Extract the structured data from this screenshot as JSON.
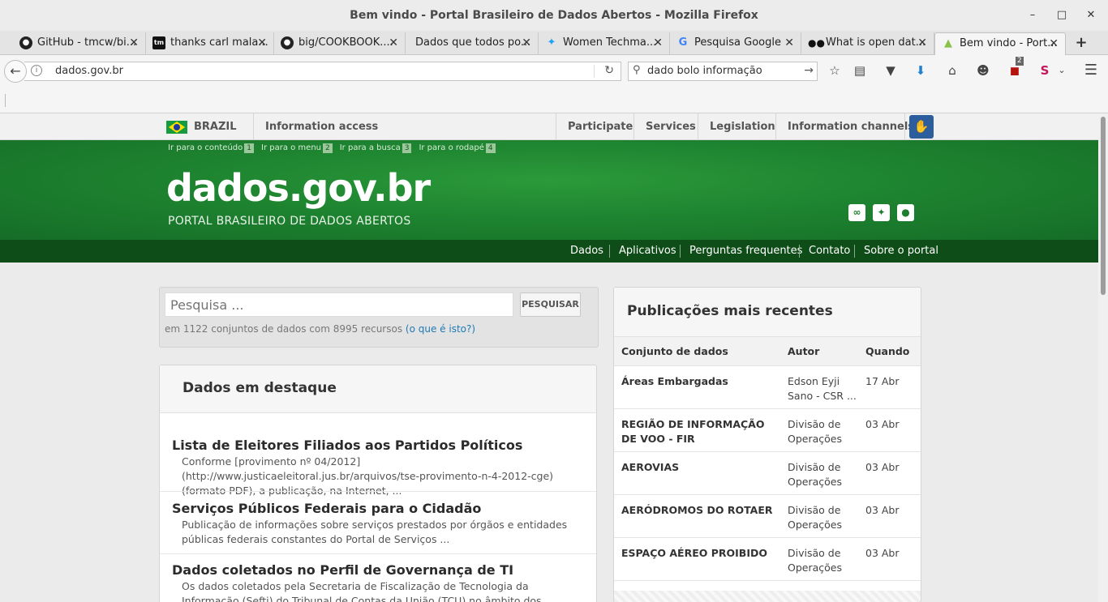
{
  "browser": {
    "window_title": "Bem vindo - Portal Brasileiro de Dados Abertos - Mozilla Firefox",
    "tabs": [
      {
        "label": "GitHub - tmcw/bi...",
        "icon": "github-icon"
      },
      {
        "label": "thanks carl mala...",
        "icon": "tm-icon"
      },
      {
        "label": "big/COOKBOOK....",
        "icon": "github-icon"
      },
      {
        "label": "Dados que todos po...",
        "icon": "none"
      },
      {
        "label": "Women Techma...",
        "icon": "twitter-icon"
      },
      {
        "label": "Pesquisa Google",
        "icon": "google-icon"
      },
      {
        "label": "What is open dat...",
        "icon": "okfn-icon"
      },
      {
        "label": "Bem vindo - Port...",
        "icon": "dados-icon"
      }
    ],
    "url": "dados.gov.br",
    "search_query": "dado bolo informação",
    "badge_count": "2",
    "colors": {
      "accent": "#1f7fd1",
      "active_tab": "#f5f5f5"
    }
  },
  "govbar": {
    "country": "BRAZIL",
    "info_access": "Information access",
    "links": [
      "Participate",
      "Services",
      "Legislation",
      "Information channels"
    ]
  },
  "header": {
    "skip_links": [
      {
        "label": "Ir para o conteúdo",
        "key": "1"
      },
      {
        "label": "Ir para o menu",
        "key": "2"
      },
      {
        "label": "Ir para a busca",
        "key": "3"
      },
      {
        "label": "Ir para o rodapé",
        "key": "4"
      }
    ],
    "title": "dados.gov.br",
    "subtitle": "PORTAL BRASILEIRO DE DADOS ABERTOS",
    "colors": {
      "green": "#1e8430",
      "dark_green": "#0e4d17"
    }
  },
  "menu": [
    "Dados",
    "Aplicativos",
    "Perguntas frequentes",
    "Contato",
    "Sobre o portal"
  ],
  "search": {
    "placeholder": "Pesquisa ...",
    "button": "PESQUISAR",
    "info_text": "em 1122 conjuntos de dados com 8995 recursos",
    "info_link": "(o que é isto?)"
  },
  "featured": {
    "heading": "Dados em destaque",
    "items": [
      {
        "title": "Lista de Eleitores Filiados aos Partidos Políticos",
        "desc": "Conforme [provimento nº 04/2012](http://www.justicaeleitoral.jus.br/arquivos/tse-provimento-n-4-2012-cge) (formato PDF), a publicação, na Internet, ..."
      },
      {
        "title": "Serviços Públicos Federais para o Cidadão",
        "desc": "Publicação de informações sobre serviços prestados por órgãos e entidades públicas federais constantes do Portal de Serviços ..."
      },
      {
        "title": "Dados coletados no Perfil de Governança de TI",
        "desc": "Os dados coletados pela Secretaria de Fiscalização de Tecnologia da Informação (Sefti) do Tribunal de Contas da União (TCU) no âmbito dos ..."
      }
    ]
  },
  "recent": {
    "heading": "Publicações mais recentes",
    "columns": [
      "Conjunto de dados",
      "Autor",
      "Quando"
    ],
    "rows": [
      {
        "dataset": "Áreas Embargadas",
        "author": "Edson Eyji Sano - CSR ...",
        "when": "17 Abr"
      },
      {
        "dataset": "REGIÃO DE INFORMAÇÃO DE VOO - FIR",
        "author": "Divisão de Operações",
        "when": "03 Abr"
      },
      {
        "dataset": "AEROVIAS",
        "author": "Divisão de Operações",
        "when": "03 Abr"
      },
      {
        "dataset": "AERÓDROMOS DO ROTAER",
        "author": "Divisão de Operações",
        "when": "03 Abr"
      },
      {
        "dataset": "ESPAÇO AÉREO PROIBIDO",
        "author": "Divisão de Operações",
        "when": "03 Abr"
      }
    ]
  }
}
